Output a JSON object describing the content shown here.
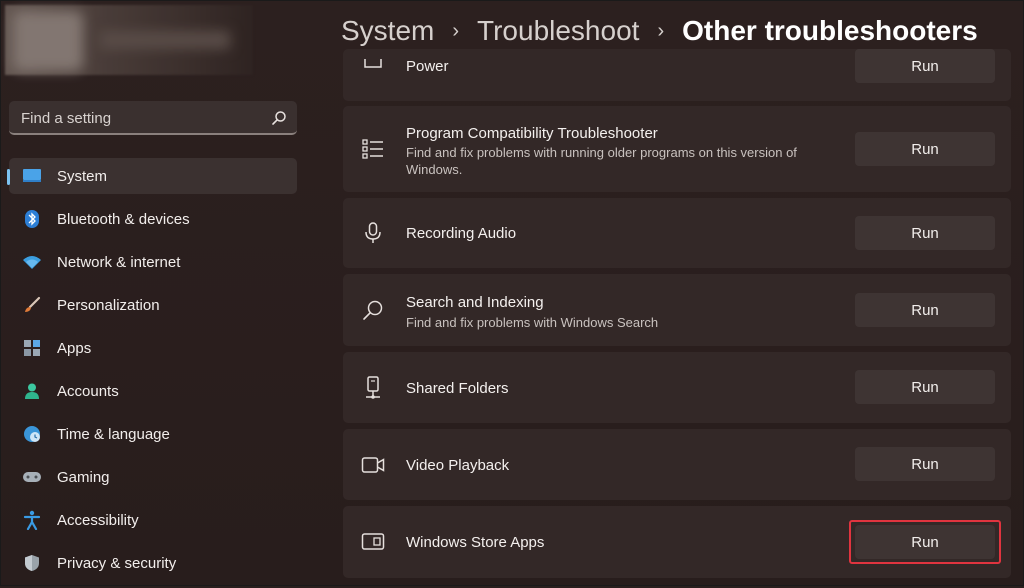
{
  "breadcrumb": {
    "items": [
      "System",
      "Troubleshoot",
      "Other troubleshooters"
    ],
    "separator": "›"
  },
  "search": {
    "placeholder": "Find a setting"
  },
  "sidebar": {
    "items": [
      {
        "label": "System",
        "icon": "monitor-icon",
        "active": true
      },
      {
        "label": "Bluetooth & devices",
        "icon": "bluetooth-icon"
      },
      {
        "label": "Network & internet",
        "icon": "wifi-icon"
      },
      {
        "label": "Personalization",
        "icon": "brush-icon"
      },
      {
        "label": "Apps",
        "icon": "apps-icon"
      },
      {
        "label": "Accounts",
        "icon": "person-icon"
      },
      {
        "label": "Time & language",
        "icon": "globe-clock-icon"
      },
      {
        "label": "Gaming",
        "icon": "gamepad-icon"
      },
      {
        "label": "Accessibility",
        "icon": "accessibility-icon"
      },
      {
        "label": "Privacy & security",
        "icon": "shield-icon"
      }
    ]
  },
  "troubleshooters": [
    {
      "title": "Power",
      "description": "",
      "icon": "battery-icon",
      "button": "Run"
    },
    {
      "title": "Program Compatibility Troubleshooter",
      "description": "Find and fix problems with running older programs on this version of Windows.",
      "icon": "list-icon",
      "button": "Run"
    },
    {
      "title": "Recording Audio",
      "description": "",
      "icon": "microphone-icon",
      "button": "Run"
    },
    {
      "title": "Search and Indexing",
      "description": "Find and fix problems with Windows Search",
      "icon": "search-icon",
      "button": "Run"
    },
    {
      "title": "Shared Folders",
      "description": "",
      "icon": "network-drive-icon",
      "button": "Run"
    },
    {
      "title": "Video Playback",
      "description": "",
      "icon": "video-camera-icon",
      "button": "Run"
    },
    {
      "title": "Windows Store Apps",
      "description": "",
      "icon": "store-apps-icon",
      "button": "Run",
      "highlighted": true
    }
  ],
  "colors": {
    "accent": "#7cc3f2",
    "highlight": "#e0343f",
    "background": "#2a1f1e",
    "card": "#332827"
  }
}
